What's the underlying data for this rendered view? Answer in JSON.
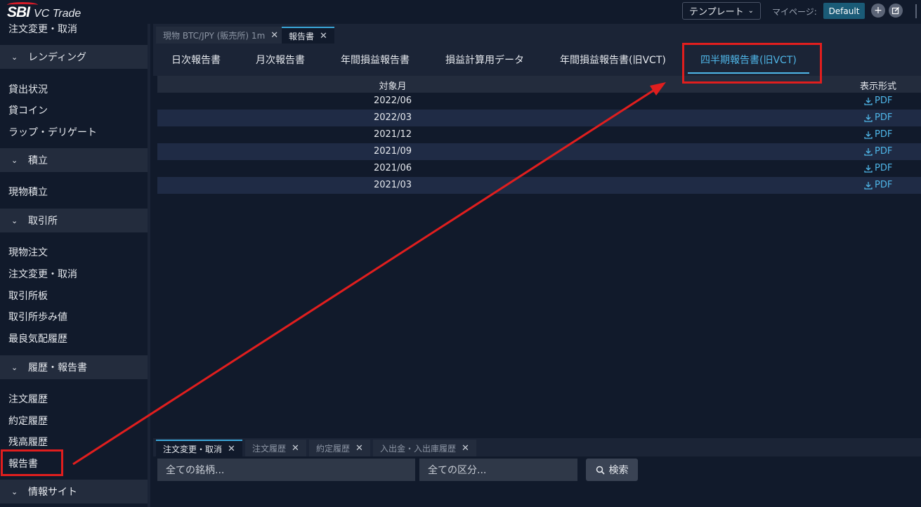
{
  "app": {
    "logo_sbi": "SBI",
    "logo_vc": "VC Trade",
    "template_label": "テンプレート",
    "mypage_label": "マイページ:",
    "default_label": "Default",
    "plus_icon": "plus-icon",
    "edit_icon": "edit-icon"
  },
  "sidebar": {
    "top_cut_item": "注文変更・取消",
    "sections": [
      {
        "title": "レンディング",
        "items": [
          "貸出状況",
          "貸コイン",
          "ラップ・デリゲート"
        ]
      },
      {
        "title": "積立",
        "items": [
          "現物積立"
        ]
      },
      {
        "title": "取引所",
        "items": [
          "現物注文",
          "注文変更・取消",
          "取引所板",
          "取引所歩み値",
          "最良気配履歴"
        ]
      },
      {
        "title": "履歴・報告書",
        "items": [
          "注文履歴",
          "約定履歴",
          "残高履歴",
          "報告書"
        ]
      },
      {
        "title": "情報サイト",
        "items": []
      }
    ]
  },
  "main": {
    "window_tabs": [
      {
        "label": "現物 BTC/JPY (販売所) 1m",
        "active": false
      },
      {
        "label": "報告書",
        "active": true
      }
    ],
    "report_tabs": [
      {
        "label": "日次報告書",
        "active": false
      },
      {
        "label": "月次報告書",
        "active": false
      },
      {
        "label": "年間損益報告書",
        "active": false
      },
      {
        "label": "損益計算用データ",
        "active": false
      },
      {
        "label": "年間損益報告書(旧VCT)",
        "active": false
      },
      {
        "label": "四半期報告書(旧VCT)",
        "active": true
      }
    ],
    "table": {
      "headers": {
        "month": "対象月",
        "format": "表示形式"
      },
      "rows": [
        {
          "month": "2022/06",
          "format": "PDF"
        },
        {
          "month": "2022/03",
          "format": "PDF"
        },
        {
          "month": "2021/12",
          "format": "PDF"
        },
        {
          "month": "2021/09",
          "format": "PDF"
        },
        {
          "month": "2021/06",
          "format": "PDF"
        },
        {
          "month": "2021/03",
          "format": "PDF"
        }
      ]
    }
  },
  "bottom": {
    "tabs": [
      {
        "label": "注文変更・取消",
        "active": true
      },
      {
        "label": "注文履歴",
        "active": false
      },
      {
        "label": "約定履歴",
        "active": false
      },
      {
        "label": "入出金・入出庫履歴",
        "active": false
      }
    ],
    "symbol_placeholder": "全ての銘柄...",
    "category_placeholder": "全ての区分...",
    "search_label": "検索"
  },
  "colors": {
    "accent": "#4fb6e8",
    "annotation": "#e01e1e",
    "background": "#111a2b"
  }
}
